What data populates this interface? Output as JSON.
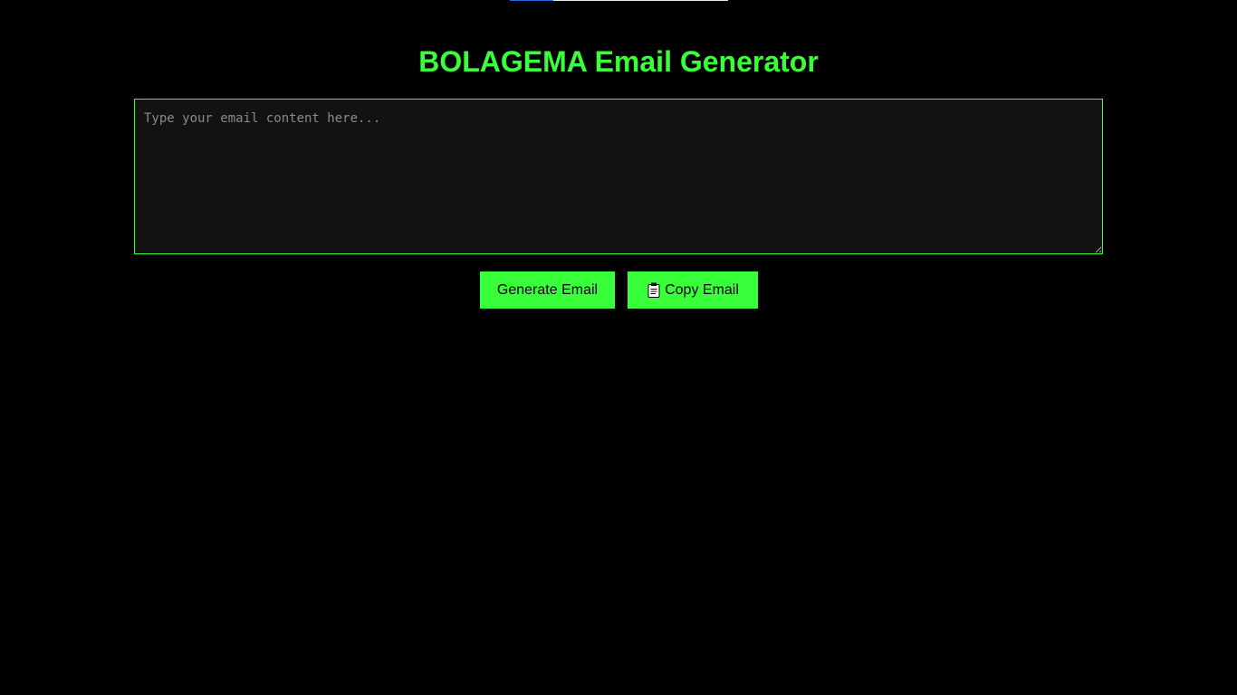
{
  "header": {
    "title": "BOLAGEMA Email Generator"
  },
  "loader": {
    "progress_percent": 20
  },
  "composer": {
    "placeholder": "Type your email content here...",
    "value": ""
  },
  "actions": {
    "generate_label": "Generate Email",
    "copy_label": "Copy Email",
    "copy_icon": "clipboard-icon"
  },
  "colors": {
    "background": "#000000",
    "accent": "#39ff3a",
    "input_background": "#121212",
    "placeholder": "#8a8a8a"
  }
}
